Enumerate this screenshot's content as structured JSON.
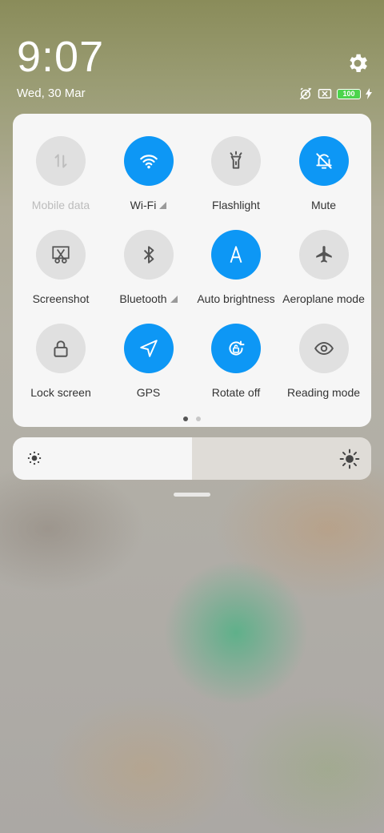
{
  "header": {
    "time": "9:07",
    "date": "Wed, 30 Mar",
    "battery_level": "100",
    "icons": [
      "alarm-off-icon",
      "no-sim-icon",
      "battery-icon",
      "charging-icon",
      "gear-icon"
    ]
  },
  "tiles": [
    {
      "label": "Mobile data",
      "state": "disabled",
      "icon": "mobile-data-icon"
    },
    {
      "label": "Wi-Fi",
      "state": "on",
      "icon": "wifi-icon",
      "expand": true
    },
    {
      "label": "Flashlight",
      "state": "off",
      "icon": "flashlight-icon"
    },
    {
      "label": "Mute",
      "state": "on",
      "icon": "bell-off-icon"
    },
    {
      "label": "Screenshot",
      "state": "off",
      "icon": "scissors-icon"
    },
    {
      "label": "Bluetooth",
      "state": "off",
      "icon": "bluetooth-icon",
      "expand": true
    },
    {
      "label": "Auto brightness",
      "state": "on",
      "icon": "letter-a-icon"
    },
    {
      "label": "Aeroplane mode",
      "state": "off",
      "icon": "airplane-icon"
    },
    {
      "label": "Lock screen",
      "state": "off",
      "icon": "lock-icon"
    },
    {
      "label": "GPS",
      "state": "on",
      "icon": "location-arrow-icon"
    },
    {
      "label": "Rotate off",
      "state": "on",
      "icon": "rotate-lock-icon"
    },
    {
      "label": "Reading mode",
      "state": "off",
      "icon": "eye-icon"
    }
  ],
  "pagination": {
    "pages": 2,
    "current": 1
  },
  "brightness": {
    "level": 0.5
  },
  "colors": {
    "accent": "#0d97f5",
    "tile_off": "#e0e0e0",
    "panel": "#f6f6f6"
  }
}
